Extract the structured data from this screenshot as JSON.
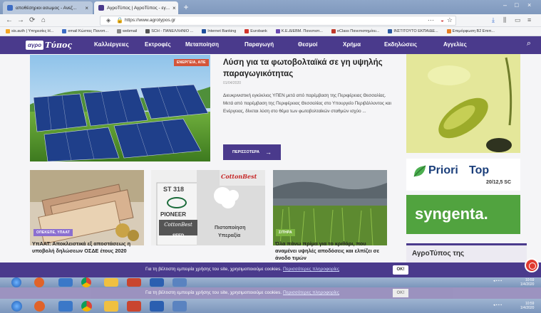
{
  "browser": {
    "tabs": [
      {
        "title": "αποθέσηριοι ασωμος - Ανεζ...",
        "active": false
      },
      {
        "title": "ΑγροΤύπος | ΑγροΤύπος - εγ...",
        "active": true
      }
    ],
    "url": "https://www.agrotypos.gr",
    "bookmarks": [
      "sis.auth | Υπηρεσίες Η...",
      "email Κώστας Πανοπ...",
      "webmail",
      "SCH - ΠΑΝΕΛΛΗΝΙΟ ...",
      "Internet Banking",
      "Eurobank",
      "Κ.Ε.ΔΙΕΒΜ. Πανεπιστ...",
      "eClass Πανεπιστημίου...",
      "ΙΝΣΤΙΤΟΥΤΟ ΕΚΠΑΙΔΕ...",
      "Επιμόρφωση Β2 Επιπ..."
    ]
  },
  "site": {
    "logo_a": "αγρο",
    "logo_b": "Τύπος",
    "menu": [
      "Καλλιέργειες",
      "Εκτροφές",
      "Μεταποίηση",
      "Παραγωγή",
      "Θεσμοί",
      "Χρήμα",
      "Εκδηλώσεις",
      "Αγγελίες"
    ]
  },
  "hero": {
    "tag": "ΕΝΕΡΓΕΙΑ, ΑΠΕ",
    "title": "Λύση για τα φωτοβολταϊκά σε γη υψηλής παραγωγικότητας",
    "date": "01/04/2020",
    "text": "Διευκρινιστική εγκύκλιος ΥΠΕΝ μετά από παρέμβαση της Περιφέρειας Θεσσαλίας. Μετά από παρέμβαση της Περιφέρειας Θεσσαλίας στο Υπουργείο Περιβάλλοντος και Ενέργειας, δίνεται λύση στο θέμα των φωτοβολταϊκών σταθμών ισχύο ...",
    "more": "ΠΕΡΙΣΣΟΤΕΡΑ"
  },
  "cards": [
    {
      "tag": "ΟΠΕΚΕΠΕ, ΥΠΑΑΤ",
      "title": "ΥπΑΑΤ: Αποκλειστικά εξ αποστάσεως η υποβολή δηλώσεων ΟΣΔΕ έτους 2020",
      "color": "#8b6fd0"
    },
    {
      "tag": "",
      "title": "",
      "color": "#e0e0e0",
      "ad": {
        "seed_code": "ST 318",
        "seed_brand": "PIONEER",
        "seed_product": "CottonBest",
        "seed_word": "SEED",
        "brand_top": "CottonBest",
        "cert_1": "Πιστοποίηση",
        "cert_2": "Υπεραξία"
      }
    },
    {
      "tag": "ΣΙΤΗΡΑ",
      "title": "Όλα πάνω πρίμα για το κριθάρι, που αναμένει υψηλές αποδόσεις και ελπίζει σε άνοδο τιμών",
      "color": "#7bb241"
    }
  ],
  "sidebar": {
    "priori": "Priori",
    "priori_top": "Top",
    "priori_sub": "20/12,5 SC",
    "syngenta": "syngenta.",
    "box_title": "ΑγροΤύπος της"
  },
  "cookie": {
    "message": "Για τη βέλτιστη εμπειρία χρήσης του site, χρησιμοποιούμε cookies. ",
    "link": "Περισσότερες πληροφορίες",
    "ok": "OK!"
  },
  "tray": {
    "time": "10:59",
    "date": "1/4/2020"
  },
  "colors": {
    "brand": "#4a3a8c",
    "accent_red": "#e03a2f"
  }
}
